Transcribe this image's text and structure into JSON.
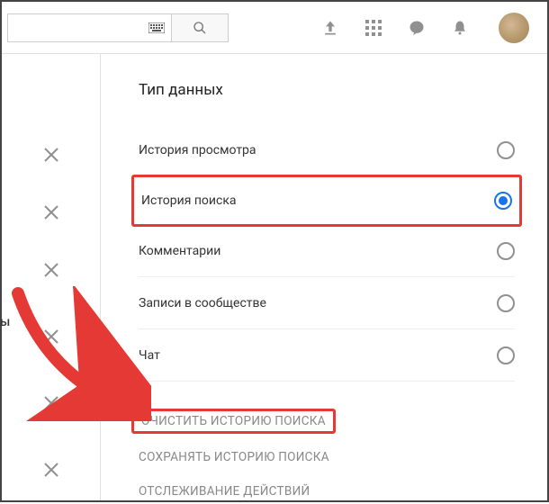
{
  "topbar": {
    "search_value": "",
    "search_placeholder": ""
  },
  "left": {
    "partial_text": "ы"
  },
  "panel": {
    "title": "Тип данных",
    "options": {
      "o1": "История просмотра",
      "o2": "История поиска",
      "o3": "Комментарии",
      "o4": "Записи в сообществе",
      "o5": "Чат"
    },
    "actions": {
      "clear": "ОЧИСТИТЬ ИСТОРИЮ ПОИСКА",
      "save": "СОХРАНЯТЬ ИСТОРИЮ ПОИСКА",
      "track": "ОТСЛЕЖИВАНИЕ ДЕЙСТВИЙ"
    }
  }
}
